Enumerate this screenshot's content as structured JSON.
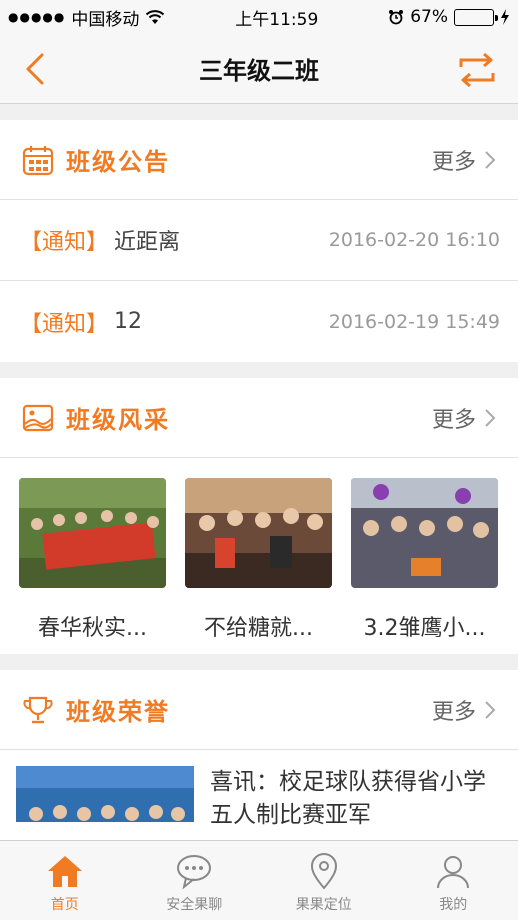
{
  "status_bar": {
    "carrier": "中国移动",
    "time": "上午11:59",
    "battery": "67%",
    "battery_level": 0.67
  },
  "nav": {
    "title": "三年级二班"
  },
  "announcements": {
    "title": "班级公告",
    "more": "更多",
    "items": [
      {
        "tag": "【通知】",
        "title": "近距离",
        "date": "2016-02-20 16:10"
      },
      {
        "tag": "【通知】",
        "title": "12",
        "date": "2016-02-19 15:49"
      }
    ]
  },
  "gallery": {
    "title": "班级风采",
    "more": "更多",
    "items": [
      {
        "caption": "春华秋实..."
      },
      {
        "caption": "不给糖就..."
      },
      {
        "caption": "3.2雏鹰小..."
      }
    ]
  },
  "honors": {
    "title": "班级荣誉",
    "more": "更多",
    "items": [
      {
        "title": "喜讯：校足球队获得省小学五人制比赛亚军"
      }
    ]
  },
  "tabbar": {
    "items": [
      {
        "label": "首页",
        "icon": "home-icon"
      },
      {
        "label": "安全果聊",
        "icon": "chat-icon"
      },
      {
        "label": "果果定位",
        "icon": "location-icon"
      },
      {
        "label": "我的",
        "icon": "user-icon"
      }
    ]
  },
  "colors": {
    "accent": "#f07b23",
    "battery": "#4cd964"
  }
}
